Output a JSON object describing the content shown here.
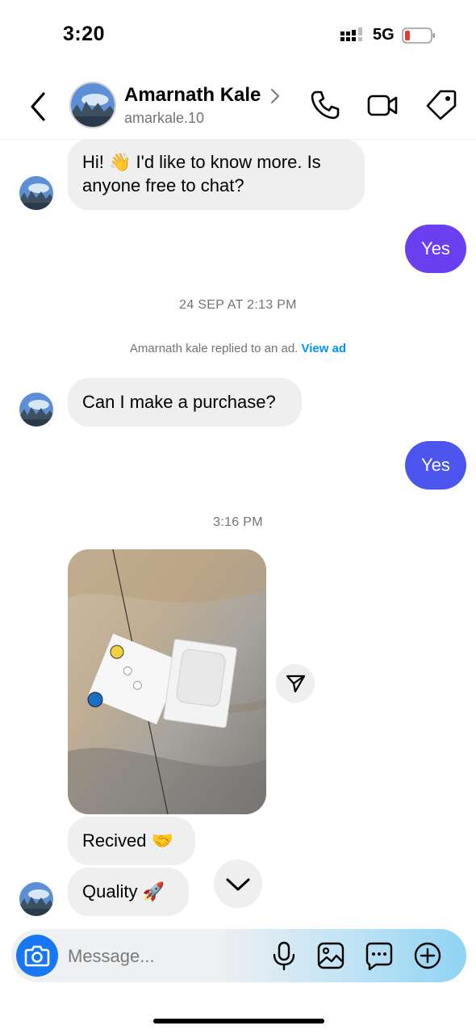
{
  "status_bar": {
    "time": "3:20",
    "network": "5G"
  },
  "header": {
    "name": "Amarnath Kale",
    "handle": "amarkale.10"
  },
  "messages": {
    "m1": "Hi! 👋 I'd like to know more. Is anyone free to chat?",
    "reply1": "Yes",
    "timestamp1": "24 SEP AT 2:13 PM",
    "notice_text": "Amarnath kale replied to an ad. ",
    "notice_link": "View ad",
    "m2": "Can I make a purchase?",
    "reply2": "Yes",
    "timestamp2": "3:16 PM",
    "m3": "Recived 🤝",
    "m4": "Quality 🚀"
  },
  "composer": {
    "placeholder": "Message..."
  },
  "colors": {
    "out_bubble_1": "#6a3ff0",
    "out_bubble_2": "#4c55ee",
    "link": "#0095f6",
    "camera": "#1877f2"
  }
}
